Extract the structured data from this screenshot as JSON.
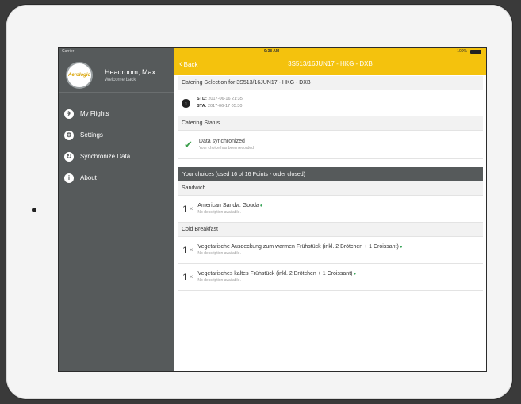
{
  "status": {
    "carrier": "Carrier",
    "time": "9:38 AM",
    "battery": "100%"
  },
  "sidebar": {
    "avatar_text": "Aerologic",
    "user_name": "Headroom, Max",
    "welcome": "Welcome back",
    "items": [
      {
        "label": "My Flights",
        "icon": "airplane-icon"
      },
      {
        "label": "Settings",
        "icon": "gear-icon"
      },
      {
        "label": "Synchronize Data",
        "icon": "sync-icon"
      },
      {
        "label": "About",
        "icon": "info-icon"
      }
    ]
  },
  "navbar": {
    "back_label": "Back",
    "title": "3S513/16JUN17 - HKG - DXB"
  },
  "catering": {
    "header": "Catering Selection for 3S513/16JUN17 - HKG - DXB",
    "std_label": "STD:",
    "std_value": "2017-06-16 21:35",
    "sta_label": "STA:",
    "sta_value": "2017-06-17 05:30"
  },
  "status_section": {
    "header": "Catering Status",
    "title": "Data synchronized",
    "subtitle": "Your choice has been recorded"
  },
  "choices": {
    "header": "Your choices (used 16 of 16 Points - order closed)",
    "groups": [
      {
        "name": "Sandwich",
        "items": [
          {
            "qty": "1",
            "name": "American Sandw. Gouda",
            "desc": "No description available."
          }
        ]
      },
      {
        "name": "Cold Breakfast",
        "items": [
          {
            "qty": "1",
            "name": "Vegetarische Ausdeckung zum warmen Frühstück (inkl. 2 Brötchen + 1 Croissant)",
            "desc": "No description available."
          },
          {
            "qty": "1",
            "name": "Vegetarisches kaltes Frühstück (inkl. 2 Brötchen + 1 Croissant)",
            "desc": "No description available."
          }
        ]
      }
    ]
  },
  "colors": {
    "navbar": "#f4c20d",
    "sidebar": "#565a5b",
    "check": "#3a9e4a"
  }
}
